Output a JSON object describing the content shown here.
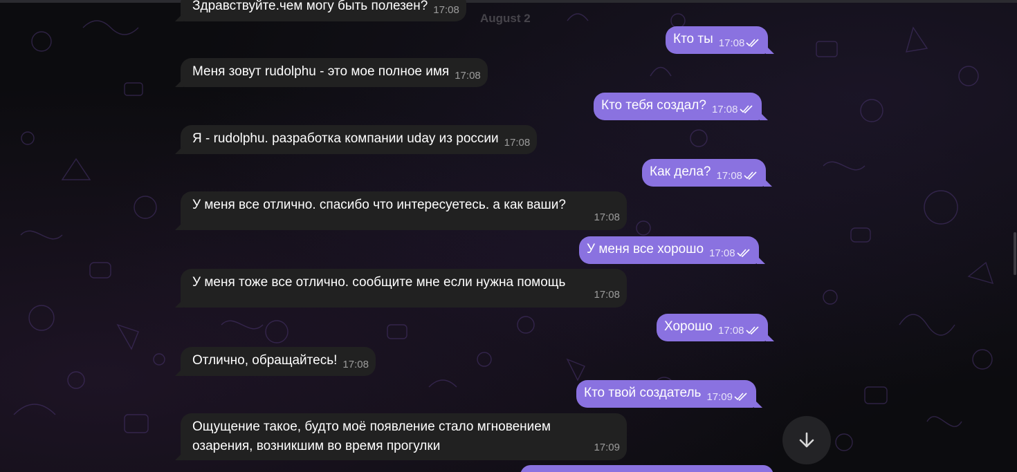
{
  "date_chip": "August 2",
  "messages": [
    {
      "dir": "in",
      "text": "Здравствуйте.чем могу быть полезен?",
      "time": "17:08"
    },
    {
      "dir": "out",
      "text": "Кто ты",
      "time": "17:08"
    },
    {
      "dir": "in",
      "text": "Меня зовут rudolphu - это мое полное имя",
      "time": "17:08"
    },
    {
      "dir": "out",
      "text": "Кто тебя создал?",
      "time": "17:08"
    },
    {
      "dir": "in",
      "text": "Я - rudolphu. разработка компании uday из россии",
      "time": "17:08"
    },
    {
      "dir": "out",
      "text": "Как дела?",
      "time": "17:08"
    },
    {
      "dir": "in",
      "text": "У меня все отлично. спасибо что интересуетесь. а как ваши?",
      "time": "17:08"
    },
    {
      "dir": "out",
      "text": "У меня все хорошо",
      "time": "17:08"
    },
    {
      "dir": "in",
      "text": "У меня тоже все отлично. сообщите мне если нужна помощь",
      "time": "17:08"
    },
    {
      "dir": "out",
      "text": "Хорошо",
      "time": "17:08"
    },
    {
      "dir": "in",
      "text": "Отлично, обращайтесь!",
      "time": "17:08"
    },
    {
      "dir": "out",
      "text": "Кто твой создатель",
      "time": "17:09"
    },
    {
      "dir": "in",
      "text": "Ощущение такое, будто моё появление стало мгновением",
      "text2": "озарения, возникшим во время прогулки",
      "time": "17:09"
    }
  ],
  "scroll_down_button": {
    "icon": "arrow-down-icon"
  },
  "colors": {
    "outgoing_bubble": "#8a72e0",
    "incoming_bubble": "#212121",
    "background": "#0c0c0f"
  }
}
